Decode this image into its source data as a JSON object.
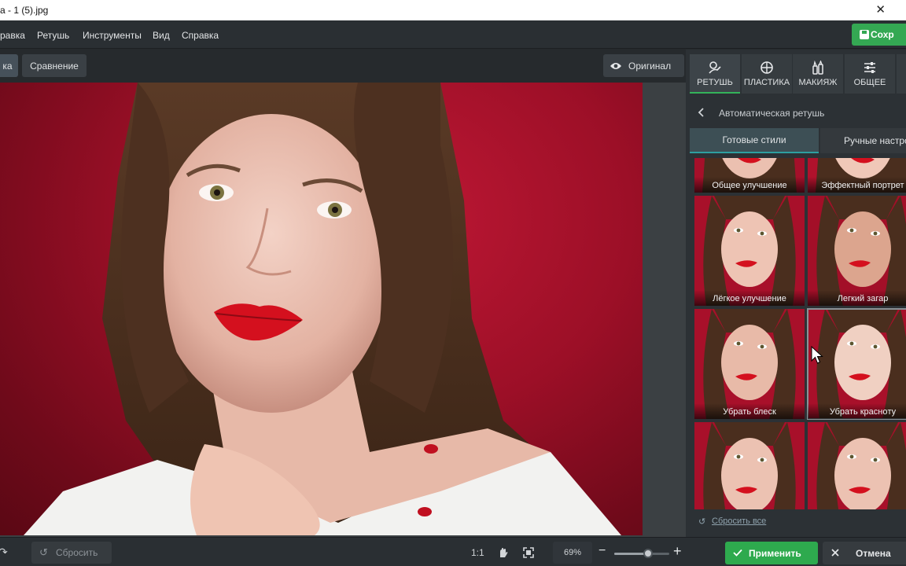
{
  "window": {
    "title": "a - 1 (5).jpg",
    "close_glyph": "✕"
  },
  "menu": {
    "items": [
      "равка",
      "Ретушь",
      "Инструменты",
      "Вид",
      "Справка"
    ],
    "save_label": "Сохр"
  },
  "toolbar": {
    "left_tab": "ка",
    "compare": "Сравнение",
    "original": "Оригинал"
  },
  "panel": {
    "tabs": [
      {
        "label": "РЕТУШЬ",
        "icon": "retouch-brush-icon"
      },
      {
        "label": "ПЛАСТИКА",
        "icon": "plastic-circle-icon"
      },
      {
        "label": "МАКИЯЖ",
        "icon": "makeup-icon"
      },
      {
        "label": "ОБЩЕЕ",
        "icon": "sliders-icon"
      }
    ],
    "back_title": "Автоматическая ретушь",
    "subtabs": {
      "presets": "Готовые стили",
      "manual": "Ручные настро"
    },
    "presets": [
      "Общее улучшение",
      "Эффектный портрет",
      "Лёгкое улучшение",
      "Легкий загар",
      "Убрать блеск",
      "Убрать краснoту",
      "",
      ""
    ],
    "reset_all": "Сбросить все"
  },
  "bottom": {
    "reset": "Сбросить",
    "ratio": "1:1",
    "zoom": "69%",
    "zoom_value": 0.62,
    "apply": "Применить",
    "cancel": "Отмена"
  },
  "colors": {
    "accent_green": "#2eaa4e",
    "panel_bg": "#2c3135",
    "photo_bg": "#9c0f27",
    "lip_red": "#d4101e"
  }
}
